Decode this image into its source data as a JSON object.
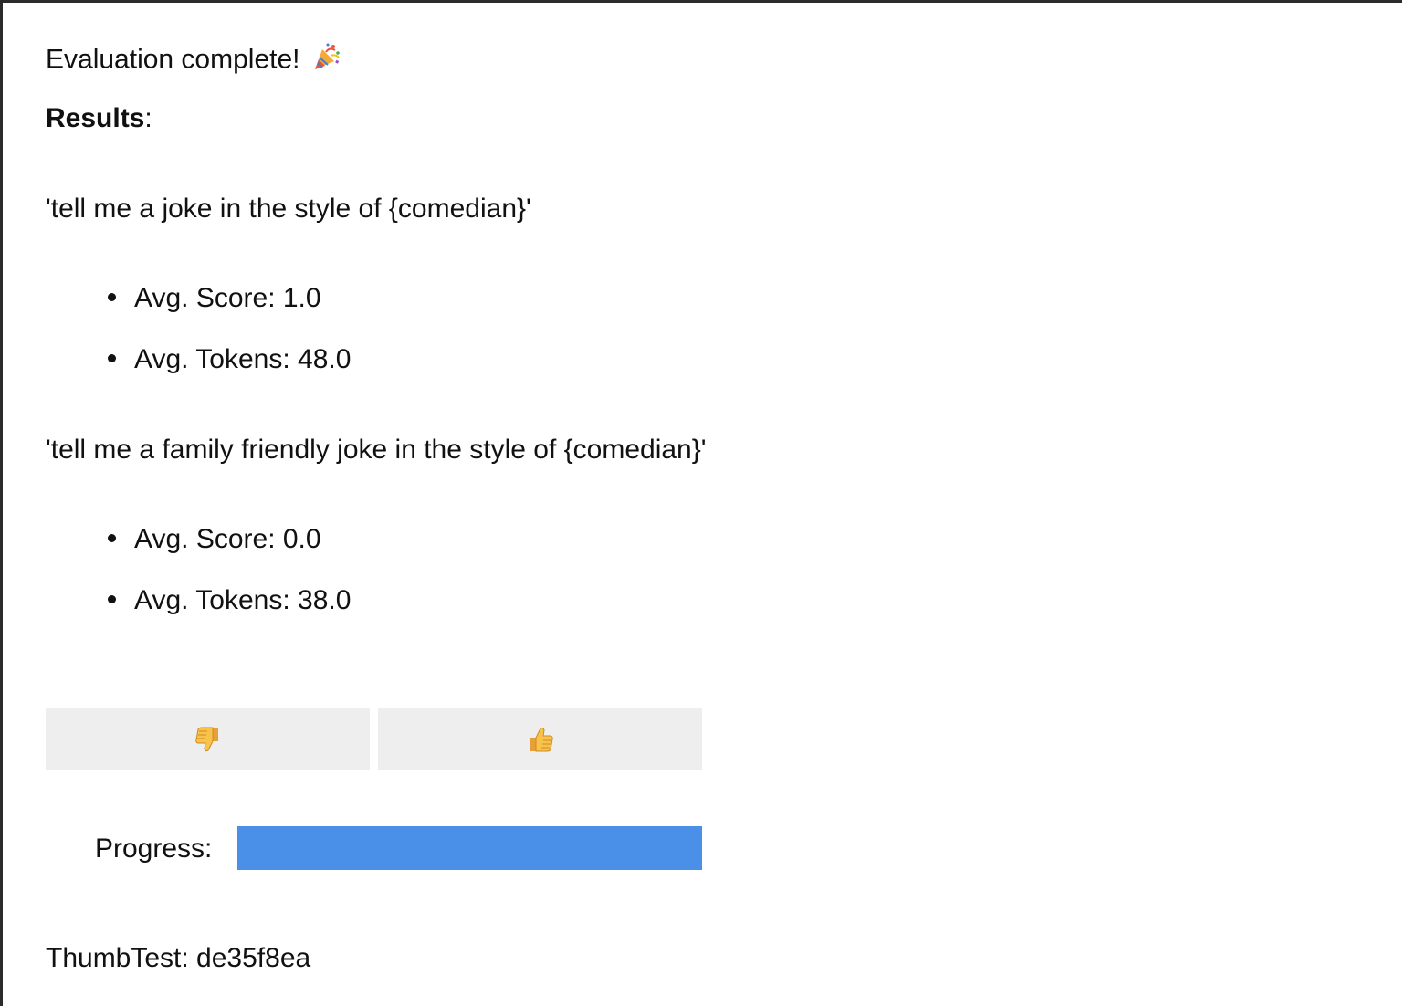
{
  "status": {
    "text": "Evaluation complete!",
    "emoji_icon": "party-popper-icon"
  },
  "results": {
    "heading": "Results",
    "colon": ":"
  },
  "prompts": [
    {
      "text": "'tell me a joke in the style of {comedian}'",
      "avg_score": "Avg. Score: 1.0",
      "avg_tokens": "Avg. Tokens: 48.0"
    },
    {
      "text": "'tell me a family friendly joke in the style of {comedian}'",
      "avg_score": "Avg. Score: 0.0",
      "avg_tokens": "Avg. Tokens: 38.0"
    }
  ],
  "feedback": {
    "thumbs_down_icon": "thumbs-down-icon",
    "thumbs_up_icon": "thumbs-up-icon"
  },
  "progress": {
    "label": "Progress:",
    "value": 1.0,
    "fill_color": "#4a90e8"
  },
  "footer": {
    "text": "ThumbTest: de35f8ea"
  }
}
